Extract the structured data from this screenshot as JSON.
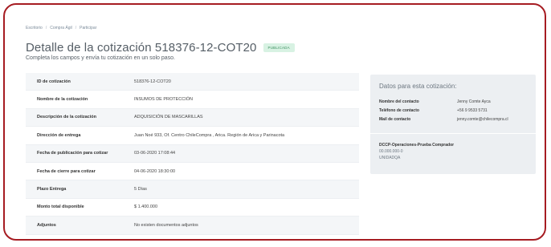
{
  "breadcrumb": [
    "Escritorio",
    "Compra Ágil",
    "Participar"
  ],
  "breadcrumb_separator": "/",
  "page": {
    "title": "Detalle de la cotización 518376-12-COT20",
    "status_badge": "PUBLICADA",
    "subtitle": "Completa los campos y envía tu cotización en un solo paso."
  },
  "details": [
    {
      "label": "ID de cotización",
      "value": "518376-12-COT20"
    },
    {
      "label": "Nombre de la cotización",
      "value": "INSUMOS DE PROTECCIÓN"
    },
    {
      "label": "Descripción de la cotización",
      "value": "ADQUISICIÓN DE MASCARILLAS"
    },
    {
      "label": "Dirección de entrega",
      "value": "Juan Noé 933, Of. Centro ChileCompra , Arica. Región de Arica y Parinacota"
    },
    {
      "label": "Fecha de publicación para cotizar",
      "value": "03-06-2020 17:08:44"
    },
    {
      "label": "Fecha de cierre para cotizar",
      "value": "04-06-2020 18:30:00"
    },
    {
      "label": "Plazo Entrega",
      "value": "5 Días"
    },
    {
      "label": "Monto total disponible",
      "value": "$ 1.400.000"
    },
    {
      "label": "Adjuntos",
      "value": "No existen documentos adjuntos"
    }
  ],
  "side_panel": {
    "title": "Datos para esta cotización:",
    "contact": [
      {
        "label": "Nombre del contacto",
        "value": "Jenny Comte Ayca"
      },
      {
        "label": "Teléfono de contacto",
        "value": "+56 9 9533 5731"
      },
      {
        "label": "Mail de contacto",
        "value": "jenny.comte@chilecompra.cl"
      }
    ],
    "buyer": {
      "name": "DCCP-Operaciones-Prueba Comprador",
      "rut": "00.000.000-0",
      "unit": "UNIDADQA"
    }
  },
  "colors": {
    "frame_border": "#a61c22",
    "badge_bg": "#d8f2e3",
    "badge_text": "#3a8f5e",
    "panel_bg": "#eceff2"
  }
}
